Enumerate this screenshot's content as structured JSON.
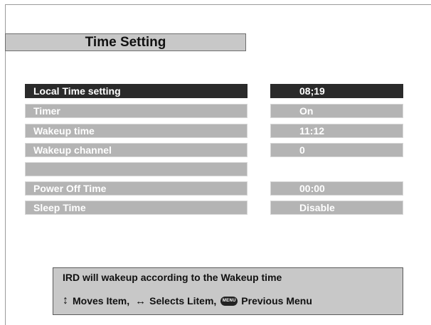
{
  "title": "Time Setting",
  "menu": {
    "rows": [
      {
        "label": "Local Time setting",
        "value": "08;19"
      },
      {
        "label": "Timer",
        "value": "On"
      },
      {
        "label": "Wakeup time",
        "value": "11:12"
      },
      {
        "label": "Wakeup channel",
        "value": "0"
      },
      {
        "label": "",
        "value": ""
      },
      {
        "label": "Power Off Time",
        "value": "00:00"
      },
      {
        "label": "Sleep Time",
        "value": "Disable"
      }
    ]
  },
  "info": {
    "message": "IRD will wakeup according to the Wakeup time",
    "moves_label": "Moves Item,",
    "selects_label": "Selects Litem,",
    "menu_icon_text": "MENU",
    "previous_label": "Previous Menu"
  },
  "colors": {
    "selected_bg": "#2a2a2a",
    "row_bg": "#b4b4b4",
    "panel_bg": "#c8c8c8"
  },
  "icons": {
    "updown": "up-down-arrow-icon",
    "leftright": "left-right-arrow-icon",
    "menu": "menu-button-icon"
  }
}
